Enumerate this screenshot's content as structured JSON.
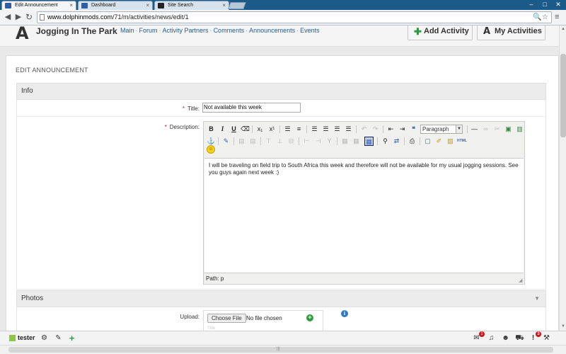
{
  "browser": {
    "tabs": [
      {
        "label": "Edit Announcement",
        "active": true
      },
      {
        "label": "Dashboard",
        "active": false
      },
      {
        "label": "Site Search",
        "active": false
      }
    ],
    "tab_close": "×",
    "url_host": "www.dolphinmods.com",
    "url_path": "/71/m/activities/news/edit/1",
    "window_controls": [
      "–",
      "□",
      "✕"
    ]
  },
  "site": {
    "logo_letter": "A",
    "title": "Jogging In The Park",
    "nav": [
      "Main",
      "Forum",
      "Activity Partners",
      "Comments",
      "Announcements",
      "Events"
    ],
    "add_activity_label": "Add Activity",
    "my_activities_label": "My Activities"
  },
  "form": {
    "page_title": "EDIT ANNOUNCEMENT",
    "info_section": "Info",
    "title_label": "Title:",
    "title_value": "Not available this week",
    "description_label": "Description:",
    "required_mark": "*",
    "format_select": "Paragraph",
    "body_text": "I will be traveling on field trip to South Africa this week and therefore will not be available for my usual jogging sessions. See you guys again next week :)",
    "path_text": "Path: p",
    "photos_section": "Photos",
    "upload_label": "Upload:",
    "choose_file_label": "Choose File",
    "no_file_text": "No file chosen",
    "faded_text": "Title"
  },
  "bottom_bar": {
    "username": "tester",
    "mail_count": "1",
    "notifications_count": "3"
  },
  "colors": {
    "accent_link": "#1f5d96",
    "add_green": "#25a03a",
    "badge_red": "#d1151b",
    "user_status": "#8dc63f"
  }
}
